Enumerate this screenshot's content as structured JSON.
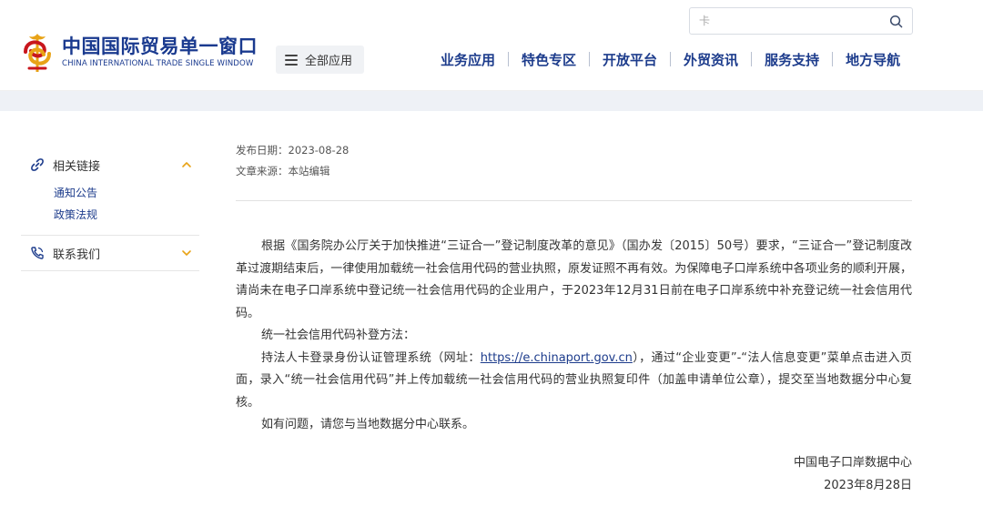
{
  "header": {
    "logo": {
      "cn": "中国国际贸易单一窗口",
      "en": "CHINA INTERNATIONAL TRADE SINGLE WINDOW"
    },
    "all_apps_label": "全部应用",
    "search": {
      "value": "",
      "placeholder": "卡"
    },
    "nav": [
      "业务应用",
      "特色专区",
      "开放平台",
      "外贸资讯",
      "服务支持",
      "地方导航"
    ]
  },
  "sidebar": {
    "groups": [
      {
        "label": "相关链接",
        "icon": "link-icon",
        "expanded": true,
        "items": [
          "通知公告",
          "政策法规"
        ]
      },
      {
        "label": "联系我们",
        "icon": "phone-icon",
        "expanded": false,
        "items": []
      }
    ]
  },
  "article": {
    "publish_label": "发布日期：",
    "publish_date": "2023-08-28",
    "source_label": "文章来源：",
    "source": "本站编辑",
    "p1": "根据《国务院办公厅关于加快推进“三证合一”登记制度改革的意见》（国办发〔2015〕50号）要求，“三证合一”登记制度改革过渡期结束后，一律使用加载统一社会信用代码的营业执照，原发证照不再有效。为保障电子口岸系统中各项业务的顺利开展，请尚未在电子口岸系统中登记统一社会信用代码的企业用户，于2023年12月31日前在电子口岸系统中补充登记统一社会信用代码。",
    "p2": "统一社会信用代码补登方法：",
    "p3_before": "持法人卡登录身份认证管理系统（网址：",
    "p3_link": "https://e.chinaport.gov.cn",
    "p3_after": "），通过“企业变更”-“法人信息变更”菜单点击进入页面，录入“统一社会信用代码”并上传加载统一社会信用代码的营业执照复印件（加盖申请单位公章），提交至当地数据分中心复核。",
    "p4": "如有问题，请您与当地数据分中心联系。",
    "signature_org": "中国电子口岸数据中心",
    "signature_date": "2023年8月28日"
  },
  "colors": {
    "brand_blue": "#1d3c8c",
    "logo_red": "#c8161d",
    "logo_gold": "#e8a317"
  }
}
